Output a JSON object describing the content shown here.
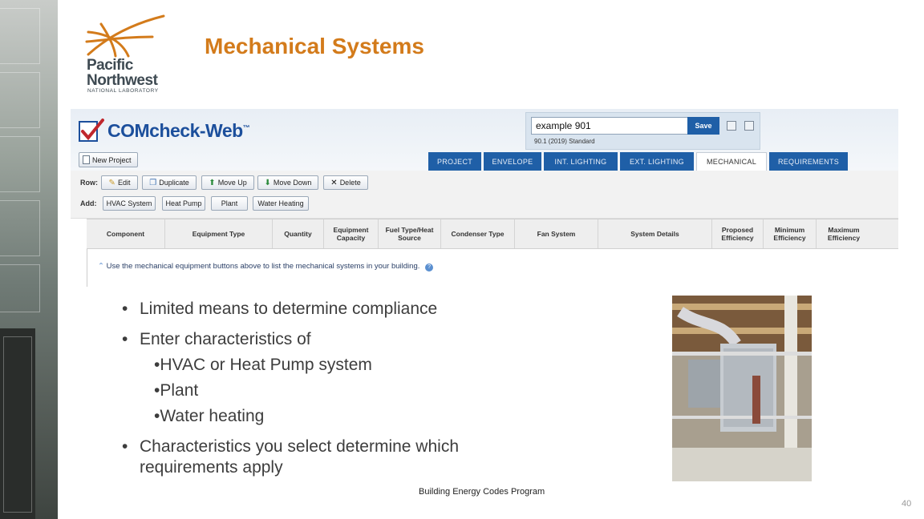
{
  "slide": {
    "title": "Mechanical Systems",
    "footer": "Building Energy Codes Program",
    "page_number": "40"
  },
  "logo": {
    "line1": "Pacific",
    "line2": "Northwest",
    "line3": "NATIONAL LABORATORY",
    "icon": "pnnl-arcs-icon",
    "color": "#d37b1b"
  },
  "app": {
    "brand": "COMcheck-Web",
    "brand_tm": "™",
    "new_project": "New Project",
    "project_name": "example 901",
    "save_label": "Save",
    "standard": "90.1 (2019) Standard",
    "tabs": [
      {
        "label": "PROJECT"
      },
      {
        "label": "ENVELOPE"
      },
      {
        "label": "INT. LIGHTING"
      },
      {
        "label": "EXT. LIGHTING"
      },
      {
        "label": "MECHANICAL",
        "active": true
      },
      {
        "label": "REQUIREMENTS"
      }
    ],
    "row_label": "Row:",
    "row_buttons": [
      {
        "label": "Edit",
        "icon": "pencil-icon"
      },
      {
        "label": "Duplicate",
        "icon": "duplicate-icon"
      },
      {
        "label": "Move Up",
        "icon": "arrow-up-icon"
      },
      {
        "label": "Move Down",
        "icon": "arrow-down-icon"
      },
      {
        "label": "Delete",
        "icon": "close-icon"
      }
    ],
    "add_label": "Add:",
    "add_buttons": [
      {
        "label": "HVAC System"
      },
      {
        "label": "Heat Pump"
      },
      {
        "label": "Plant"
      },
      {
        "label": "Water Heating"
      }
    ],
    "columns": [
      "Component",
      "Equipment Type",
      "Quantity",
      "Equipment Capacity",
      "Fuel Type/Heat Source",
      "Condenser Type",
      "Fan System",
      "System Details",
      "Proposed Efficiency",
      "Minimum Efficiency",
      "Maximum Efficiency"
    ],
    "hint": "Use the mechanical equipment buttons above to list the mechanical systems in your building.",
    "accent": "#1f5fa7"
  },
  "bullets": {
    "b1": "Limited means to determine compliance",
    "b2": "Enter characteristics of",
    "b2_subs": [
      "HVAC or Heat Pump system",
      "Plant",
      "Water heating"
    ],
    "b3_line1": "Characteristics you select determine which",
    "b3_line2": "requirements apply",
    "bullet_char": "•"
  }
}
